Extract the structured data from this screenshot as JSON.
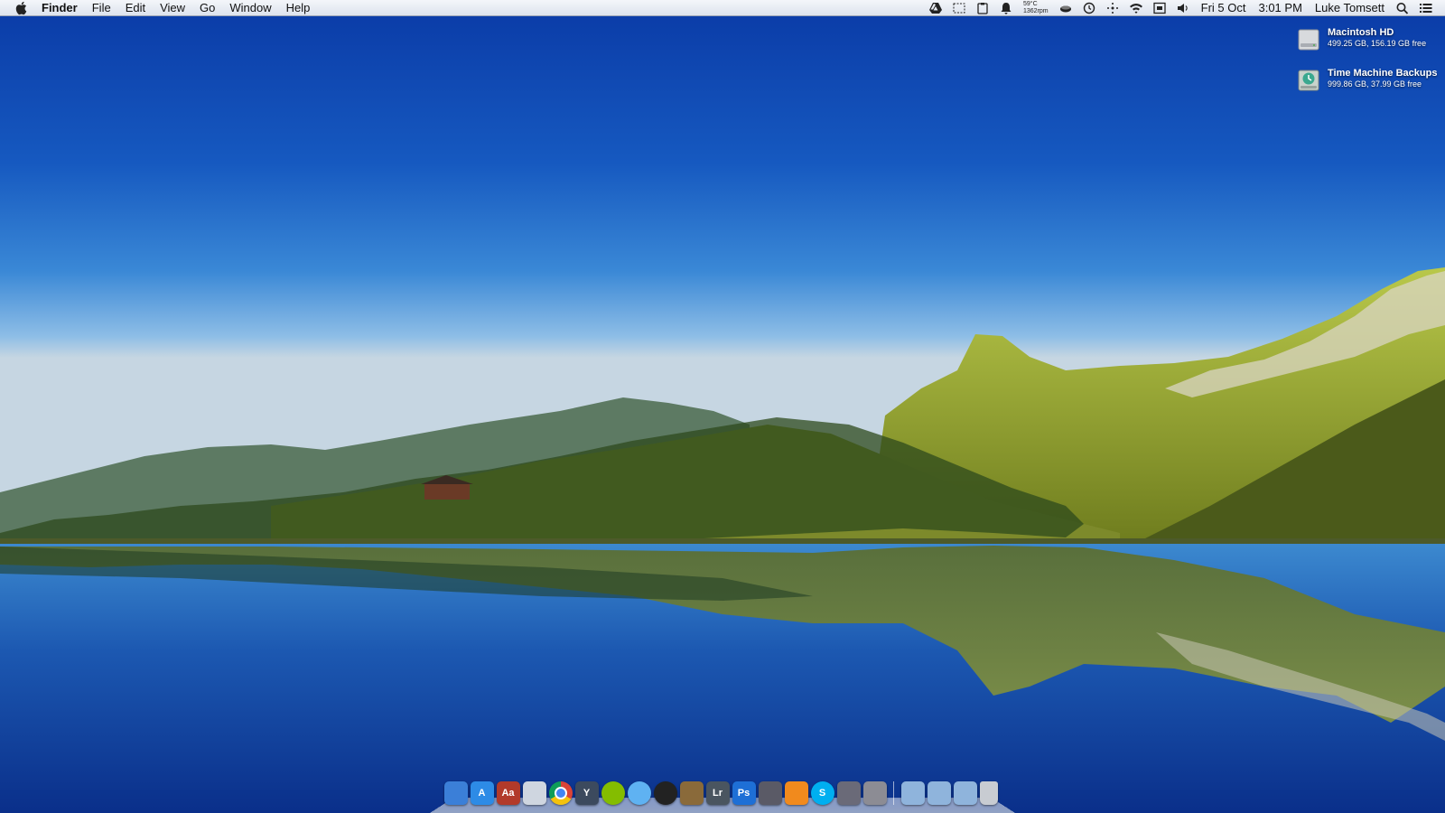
{
  "menubar": {
    "app_name": "Finder",
    "menus": [
      "File",
      "Edit",
      "View",
      "Go",
      "Window",
      "Help"
    ],
    "status": {
      "temperature": "59°C",
      "fan_speed": "1362rpm",
      "date": "Fri 5 Oct",
      "time": "3:01 PM",
      "user": "Luke Tomsett"
    },
    "status_icons": [
      "google-drive-icon",
      "screenshot-icon",
      "clipboard-icon",
      "notification-icon",
      "temperature-fan",
      "cup-icon",
      "time-machine-icon",
      "bluetooth-icon",
      "wifi-icon",
      "input-icon",
      "volume-icon",
      "spotlight-icon",
      "notification-center-icon"
    ]
  },
  "desktop_items": [
    {
      "name": "Macintosh HD",
      "info": "499.25 GB, 156.19 GB free",
      "icon": "hard-drive-icon"
    },
    {
      "name": "Time Machine Backups",
      "info": "999.86 GB, 37.99 GB free",
      "icon": "time-machine-drive-icon"
    }
  ],
  "dock": {
    "apps": [
      {
        "name": "finder",
        "label": "",
        "color": "#3b7fd8"
      },
      {
        "name": "app-store",
        "label": "A",
        "color": "#2d8be6"
      },
      {
        "name": "dictionary",
        "label": "Aa",
        "color": "#b23a2a"
      },
      {
        "name": "preview",
        "label": "",
        "color": "#cfd6e0"
      },
      {
        "name": "chrome",
        "label": "",
        "color": "#ffffff"
      },
      {
        "name": "yoink",
        "label": "Y",
        "color": "#3c4a5e"
      },
      {
        "name": "spotify",
        "label": "",
        "color": "#84bd00"
      },
      {
        "name": "messages",
        "label": "",
        "color": "#5fb2f2"
      },
      {
        "name": "aperture",
        "label": "",
        "color": "#222222"
      },
      {
        "name": "iphoto",
        "label": "",
        "color": "#8a6a3a"
      },
      {
        "name": "lightroom",
        "label": "Lr",
        "color": "#4a5560"
      },
      {
        "name": "photoshop",
        "label": "Ps",
        "color": "#1e6fd6"
      },
      {
        "name": "final-cut",
        "label": "",
        "color": "#5a5a66"
      },
      {
        "name": "vlc",
        "label": "",
        "color": "#f18a1d"
      },
      {
        "name": "skype",
        "label": "S",
        "color": "#00aff0"
      },
      {
        "name": "script-editor",
        "label": "",
        "color": "#6a6a78"
      },
      {
        "name": "system-preferences",
        "label": "",
        "color": "#8c8c94"
      }
    ],
    "stacks": [
      {
        "name": "applications-folder",
        "color": "#8fb4dc"
      },
      {
        "name": "documents-folder",
        "color": "#8fb4dc"
      },
      {
        "name": "downloads-folder",
        "color": "#8fb4dc"
      },
      {
        "name": "trash",
        "color": "#c8ccd2"
      }
    ]
  }
}
